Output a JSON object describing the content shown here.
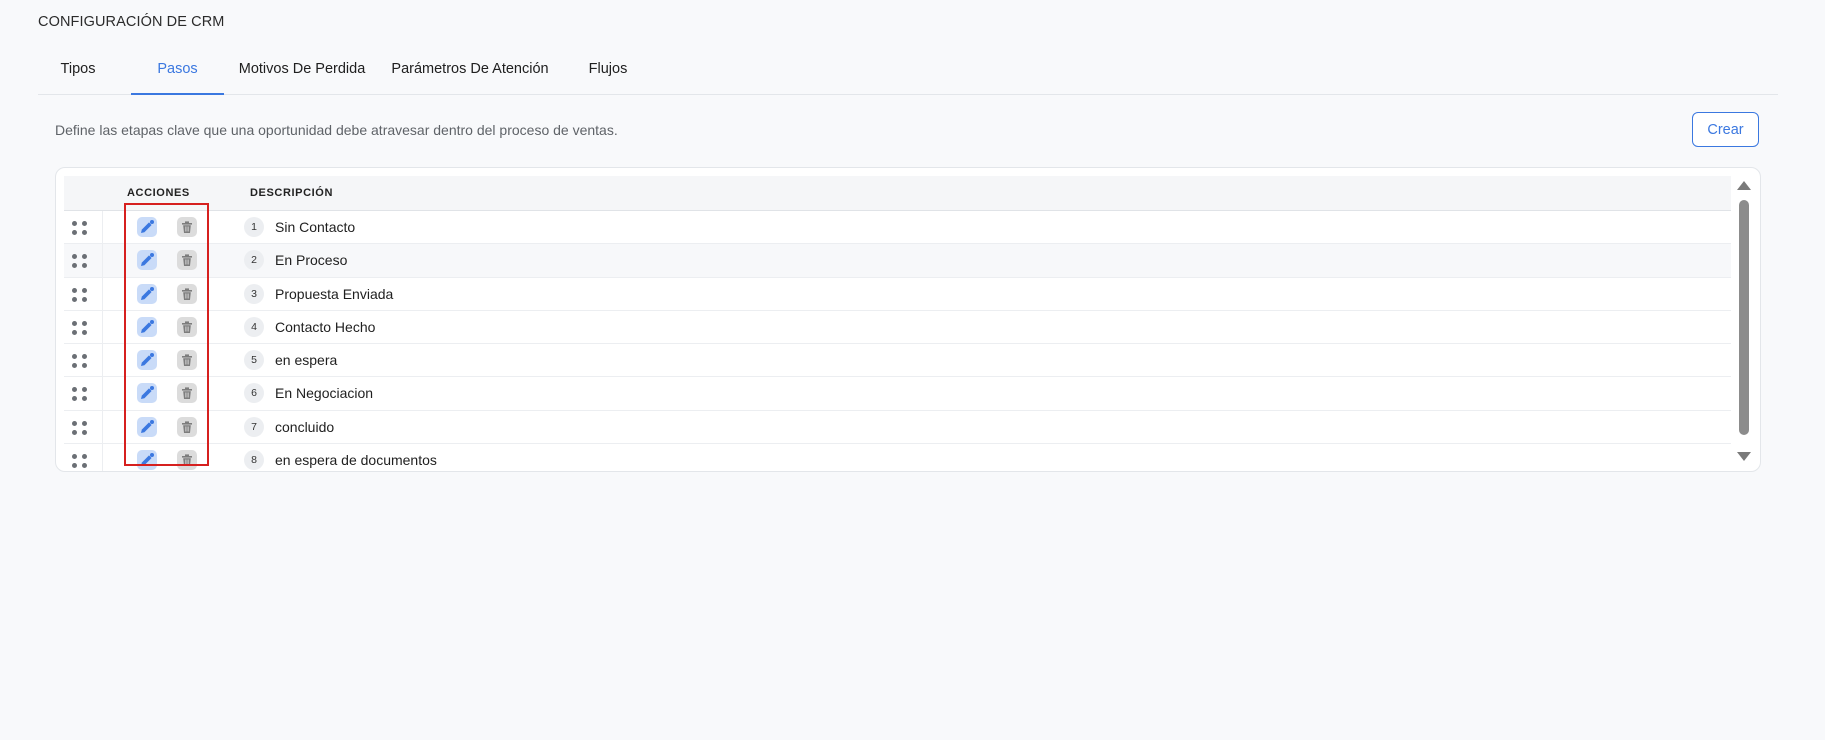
{
  "page": {
    "title": "CONFIGURACIÓN DE CRM"
  },
  "tabs": [
    {
      "label": "Tipos",
      "active": false
    },
    {
      "label": "Pasos",
      "active": true
    },
    {
      "label": "Motivos De Perdida",
      "active": false
    },
    {
      "label": "Parámetros De Atención",
      "active": false
    },
    {
      "label": "Flujos",
      "active": false
    }
  ],
  "section": {
    "description": "Define las etapas clave que una oportunidad debe atravesar dentro del proceso de ventas.",
    "create_label": "Crear"
  },
  "table": {
    "columns": {
      "actions": "ACCIONES",
      "description": "DESCRIPCIÓN"
    },
    "rows": [
      {
        "step": "1",
        "name": "Sin Contacto"
      },
      {
        "step": "2",
        "name": "En Proceso"
      },
      {
        "step": "3",
        "name": "Propuesta Enviada"
      },
      {
        "step": "4",
        "name": "Contacto Hecho"
      },
      {
        "step": "5",
        "name": "en espera"
      },
      {
        "step": "6",
        "name": "En Negociacion"
      },
      {
        "step": "7",
        "name": "concluido"
      },
      {
        "step": "8",
        "name": "en espera de documentos"
      }
    ]
  },
  "icons": {
    "drag": "drag-handle-icon",
    "edit": "pencil-icon",
    "delete": "trash-icon"
  },
  "colors": {
    "accent": "#3b78e0",
    "highlight": "#d6201f"
  }
}
